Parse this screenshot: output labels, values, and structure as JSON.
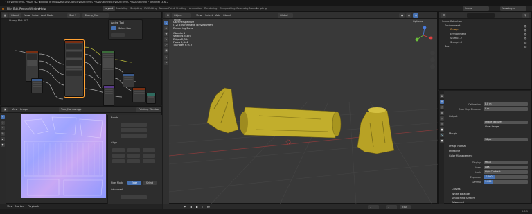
{
  "titlebar": {
    "title": "* Environment Props (D:\\Environment\\Desktop\\3D\\Environment Props\\Blend\\Environment Props\\Blend) - Blender 3.6.5"
  },
  "menu": [
    "File",
    "Edit",
    "Render",
    "Window",
    "Help"
  ],
  "workspaces": [
    "Layout",
    "Modeling",
    "Sculpting",
    "UV Editing",
    "Texture Paint",
    "Shading",
    "Animation",
    "Rendering",
    "Compositing",
    "Geometry Nodes",
    "Scripting"
  ],
  "active_workspace": "Layout",
  "scene_field": "Scene",
  "viewlayer_field": "ViewLayer",
  "node_editor": {
    "mode": "Object",
    "menus": [
      "View",
      "Select",
      "Add",
      "Node"
    ],
    "material_slot": "Slot 1",
    "material_name": "Stump_Mat",
    "breadcrumb": "Stump.Mat.002",
    "popup": {
      "title": "Active Tool",
      "item": "Select Box"
    }
  },
  "image_editor": {
    "menus": [
      "View",
      "Image"
    ],
    "image_name": "Tree_Normal.rgb",
    "mode": "Painting Window",
    "panel_title": "Brush",
    "sections": [
      "Align"
    ],
    "pixel_mode": "Pixel Mode",
    "bottom_buttons": [
      "Edge",
      "Select"
    ],
    "more": "Advanced"
  },
  "viewport": {
    "mode": "Object Mode",
    "menus": [
      "View",
      "Select",
      "Add",
      "Object"
    ],
    "transform": "Global",
    "options_label": "Options",
    "overlay_text": [
      "User Perspective",
      "(12) Environment | Environment",
      "Rendering Done",
      "",
      "Objects      4",
      "Vertices    5,376",
      "Edges       2,364",
      "Faces       5,444",
      "Triangles   6,917"
    ]
  },
  "outliner": {
    "title": "Scene Collection",
    "items": [
      {
        "name": "Environment",
        "level": 0
      },
      {
        "name": "Stump",
        "level": 1
      },
      {
        "name": "Environment",
        "level": 1
      },
      {
        "name": "Stump1.2",
        "level": 1
      },
      {
        "name": "Stump1.3",
        "level": 1
      },
      {
        "name": "Box",
        "level": 0
      }
    ]
  },
  "properties": {
    "fields": [
      {
        "label": "Calibration",
        "value": "8.8 m"
      },
      {
        "label": "Max Step Distance",
        "value": "0 m"
      }
    ],
    "sections": [
      "Output",
      "Margin",
      "Image Format",
      "Freestyle",
      "Color Management",
      "Curves",
      "White Balance",
      "Smoothing System",
      "Advanced"
    ],
    "output_target": "Image Textures",
    "clear_image_label": "Clear Image",
    "margin_size": "16 px",
    "color_fields": [
      {
        "label": "Display",
        "value": "sRGB"
      },
      {
        "label": "View",
        "value": "AgX"
      },
      {
        "label": "Look",
        "value": "High Contrast"
      },
      {
        "label": "Exposure",
        "value": "-0.500"
      },
      {
        "label": "Gamma",
        "value": "1.000"
      }
    ]
  },
  "timeline": {
    "frame_current": "1",
    "start": "1",
    "end": "250"
  },
  "status": {
    "left": [
      "View",
      "Marker",
      "Playback"
    ],
    "right": "3.6.5"
  },
  "colors": {
    "accent": "#4772b3",
    "node_header": "#7a2f12",
    "selected": "#ffa133",
    "viewport": "#393939",
    "log": "#b8a42a"
  }
}
